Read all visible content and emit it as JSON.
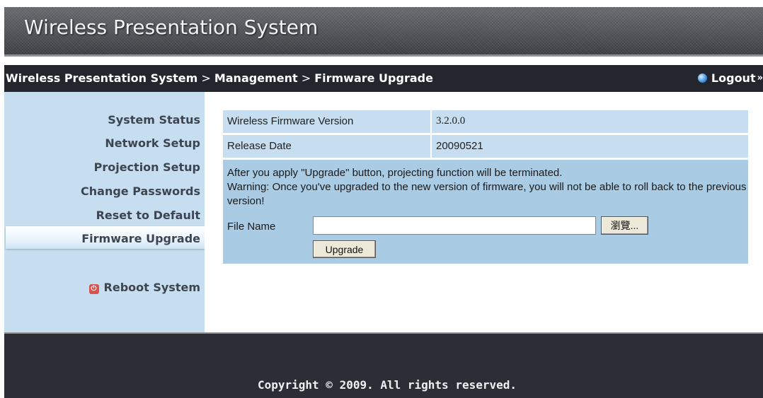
{
  "header": {
    "title": "Wireless Presentation System"
  },
  "breadcrumb": {
    "root": "Wireless Presentation System",
    "sep1": " > ",
    "section": "Management",
    "sep2": " > ",
    "page": "Firmware Upgrade"
  },
  "logout": {
    "label": "Logout",
    "arrows": "»",
    "icon": "globe-icon"
  },
  "sidebar": {
    "items": [
      {
        "label": "System Status"
      },
      {
        "label": "Network Setup"
      },
      {
        "label": "Projection Setup"
      },
      {
        "label": "Change Passwords"
      },
      {
        "label": "Reset to Default"
      },
      {
        "label": "Firmware Upgrade",
        "active": true
      }
    ],
    "reboot": {
      "label": "Reboot System",
      "icon": "power-icon"
    }
  },
  "firmware": {
    "version_label": "Wireless Firmware Version",
    "version_value": "3.2.0.0",
    "date_label": "Release Date",
    "date_value": "20090521",
    "note_line1": "After you apply \"Upgrade\" button, projecting function will be terminated.",
    "note_line2": "Warning: Once you've upgraded to the new version of firmware, you will not be able to roll back to the previous version!",
    "file_label": "File Name",
    "file_value": "",
    "browse_label": "瀏覽...",
    "upgrade_label": "Upgrade"
  },
  "footer": {
    "copyright": "Copyright © 2009. All rights reserved."
  },
  "colors": {
    "panel": "#c6deef",
    "panel_dark": "#a9cbe3",
    "bar": "#23262d",
    "footer": "#2b2e34"
  }
}
